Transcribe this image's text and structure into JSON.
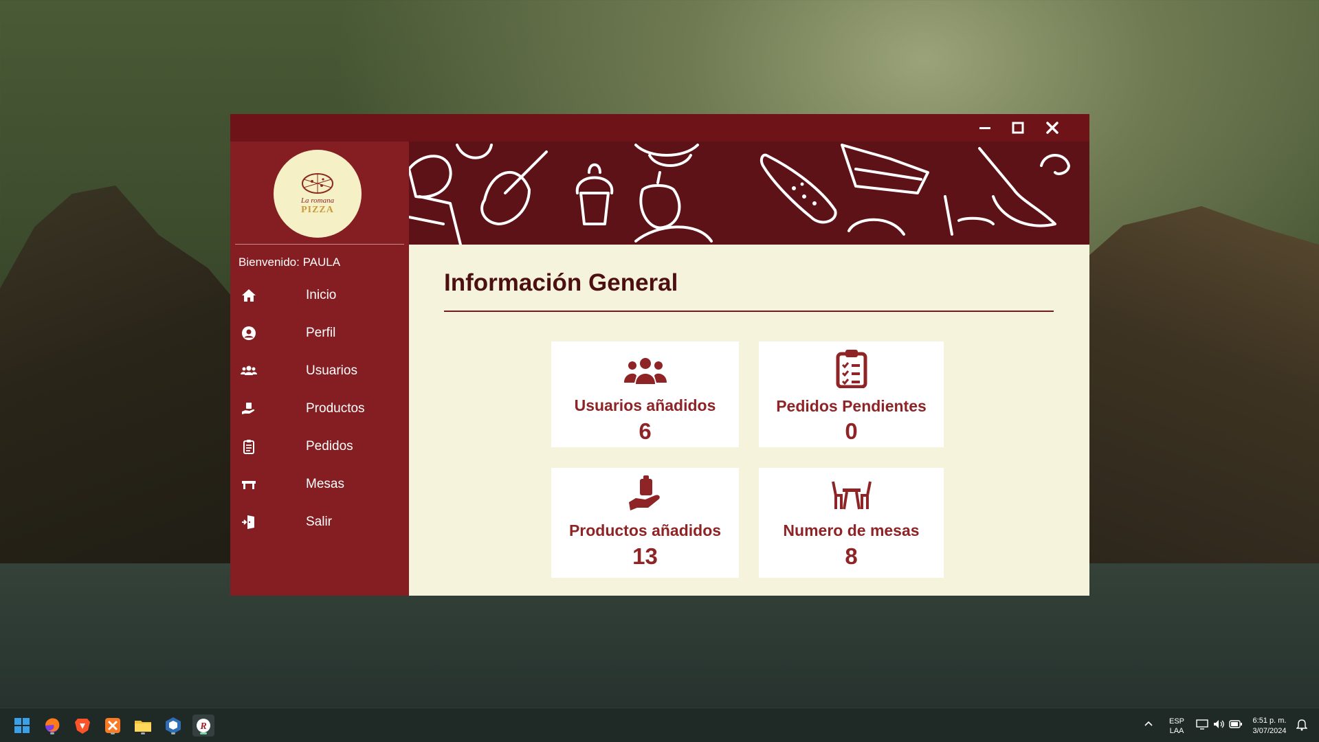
{
  "window": {
    "logo": {
      "line1": "La romana",
      "line2": "PIZZA"
    },
    "welcome_label": "Bienvenido:",
    "welcome_user": "PAULA",
    "nav": [
      {
        "label": "Inicio",
        "icon": "home-icon"
      },
      {
        "label": "Perfil",
        "icon": "user-icon"
      },
      {
        "label": "Usuarios",
        "icon": "users-icon"
      },
      {
        "label": "Productos",
        "icon": "hand-box-icon"
      },
      {
        "label": "Pedidos",
        "icon": "clipboard-icon"
      },
      {
        "label": "Mesas",
        "icon": "table-icon"
      },
      {
        "label": "Salir",
        "icon": "exit-icon"
      }
    ]
  },
  "main": {
    "title": "Información General",
    "cards": [
      {
        "label": "Usuarios añadidos",
        "value": "6",
        "icon": "users-icon"
      },
      {
        "label": "Pedidos Pendientes",
        "value": "0",
        "icon": "clipboard-check-icon"
      },
      {
        "label": "Productos añadidos",
        "value": "13",
        "icon": "hand-box-icon"
      },
      {
        "label": "Numero de mesas",
        "value": "8",
        "icon": "table-chairs-icon"
      }
    ]
  },
  "taskbar": {
    "apps": [
      "start-icon",
      "firefox-icon",
      "brave-icon",
      "xampp-icon",
      "file-explorer-icon",
      "virtualbox-icon",
      "app-r-icon"
    ],
    "language_line1": "ESP",
    "language_line2": "LAA",
    "time": "6:51 p. m.",
    "date": "3/07/2024"
  },
  "colors": {
    "titlebar": "#6e1419",
    "sidebar": "#841e22",
    "content_bg": "#f6f3dc",
    "accent_text": "#8e2426",
    "heading": "#4d1012"
  }
}
